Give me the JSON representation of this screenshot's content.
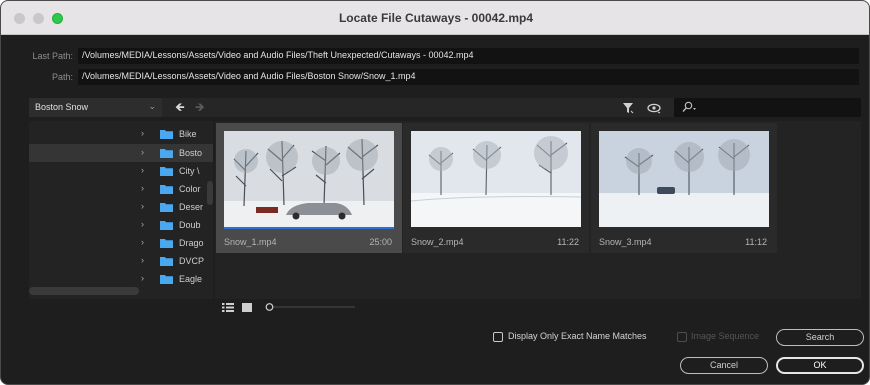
{
  "window": {
    "title": "Locate File Cutaways - 00042.mp4"
  },
  "paths": {
    "last_path_label": "Last Path:",
    "last_path_value": "/Volumes/MEDIA/Lessons/Assets/Video and Audio Files/Theft Unexpected/Cutaways - 00042.mp4",
    "path_label": "Path:",
    "path_value": "/Volumes/MEDIA/Lessons/Assets/Video and Audio Files/Boston Snow/Snow_1.mp4"
  },
  "toolbar": {
    "location": "Boston Snow",
    "icons": [
      "chevron-down-icon",
      "arrow-left-icon",
      "arrow-right-icon",
      "filter-icon",
      "eye-icon",
      "search-icon"
    ],
    "search_value": ""
  },
  "folders": [
    {
      "label": "Bike",
      "selected": false
    },
    {
      "label": "Bosto",
      "selected": true
    },
    {
      "label": "City \\",
      "selected": false
    },
    {
      "label": "Color",
      "selected": false
    },
    {
      "label": "Deser",
      "selected": false
    },
    {
      "label": "Doub",
      "selected": false
    },
    {
      "label": "Drago",
      "selected": false
    },
    {
      "label": "DVCP",
      "selected": false
    },
    {
      "label": "Eagle",
      "selected": false
    }
  ],
  "thumbnails": [
    {
      "name": "Snow_1.mp4",
      "duration": "25:00",
      "selected": true
    },
    {
      "name": "Snow_2.mp4",
      "duration": "11:22",
      "selected": false
    },
    {
      "name": "Snow_3.mp4",
      "duration": "11:12",
      "selected": false
    }
  ],
  "options": {
    "exact_name_label": "Display Only Exact Name Matches",
    "exact_name_checked": false,
    "image_sequence_label": "Image Sequence",
    "image_sequence_checked": false,
    "image_sequence_enabled": false
  },
  "buttons": {
    "search": "Search",
    "cancel": "Cancel",
    "ok": "OK"
  },
  "colors": {
    "dialog_bg": "#1e1e1e",
    "titlebar_bg": "#e6e4e6",
    "folder": "#4aa8f0",
    "selection": "#4a4a4a",
    "zoom_green": "#2ec949"
  }
}
